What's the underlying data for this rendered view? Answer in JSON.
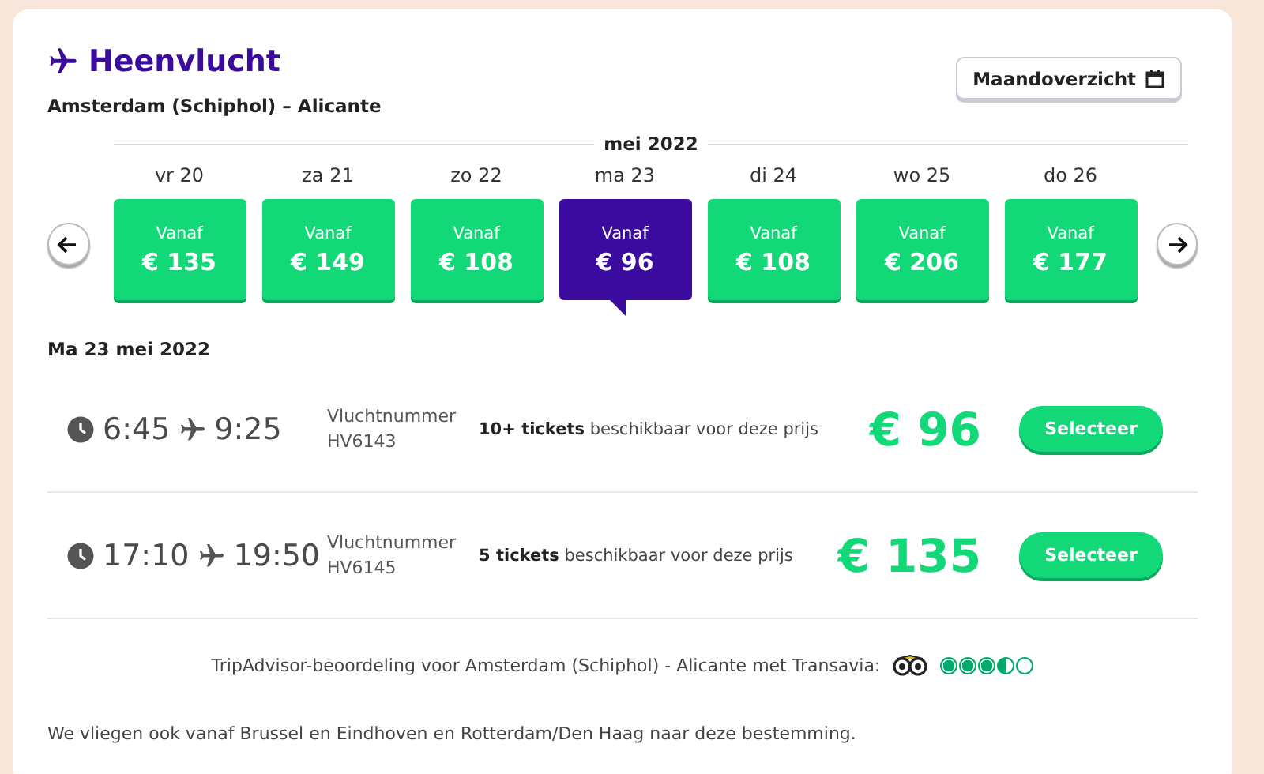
{
  "header": {
    "title": "Heenvlucht",
    "route": "Amsterdam (Schiphol) – Alicante",
    "month_overview_button": "Maandoverzicht"
  },
  "date_strip": {
    "month": "mei 2022",
    "days": [
      {
        "day": "vr 20",
        "label": "Vanaf",
        "price": "€ 135",
        "selected": false
      },
      {
        "day": "za 21",
        "label": "Vanaf",
        "price": "€ 149",
        "selected": false
      },
      {
        "day": "zo 22",
        "label": "Vanaf",
        "price": "€ 108",
        "selected": false
      },
      {
        "day": "ma 23",
        "label": "Vanaf",
        "price": "€ 96",
        "selected": true
      },
      {
        "day": "di 24",
        "label": "Vanaf",
        "price": "€ 108",
        "selected": false
      },
      {
        "day": "wo 25",
        "label": "Vanaf",
        "price": "€ 206",
        "selected": false
      },
      {
        "day": "do 26",
        "label": "Vanaf",
        "price": "€ 177",
        "selected": false
      }
    ]
  },
  "selected_date": "Ma 23 mei 2022",
  "flights": [
    {
      "departure": "6:45",
      "arrival": "9:25",
      "flight_number_label": "Vluchtnummer",
      "flight_number": "HV6143",
      "availability": "**10+ tickets** beschikbaar voor deze prijs",
      "price": "€ 96",
      "button": "Selecteer"
    },
    {
      "departure": "17:10",
      "arrival": "19:50",
      "flight_number_label": "Vluchtnummer",
      "flight_number": "HV6145",
      "availability": "**5 tickets** beschikbaar voor deze prijs",
      "price": "€ 135",
      "button": "Selecteer"
    }
  ],
  "rating": {
    "text": "TripAdvisor-beoordeling voor Amsterdam (Schiphol) - Alicante met Transavia:",
    "stars": 3.5
  },
  "footer_note": "We vliegen ook vanaf Brussel en Eindhoven en Rotterdam/Den Haag naar deze bestemming."
}
